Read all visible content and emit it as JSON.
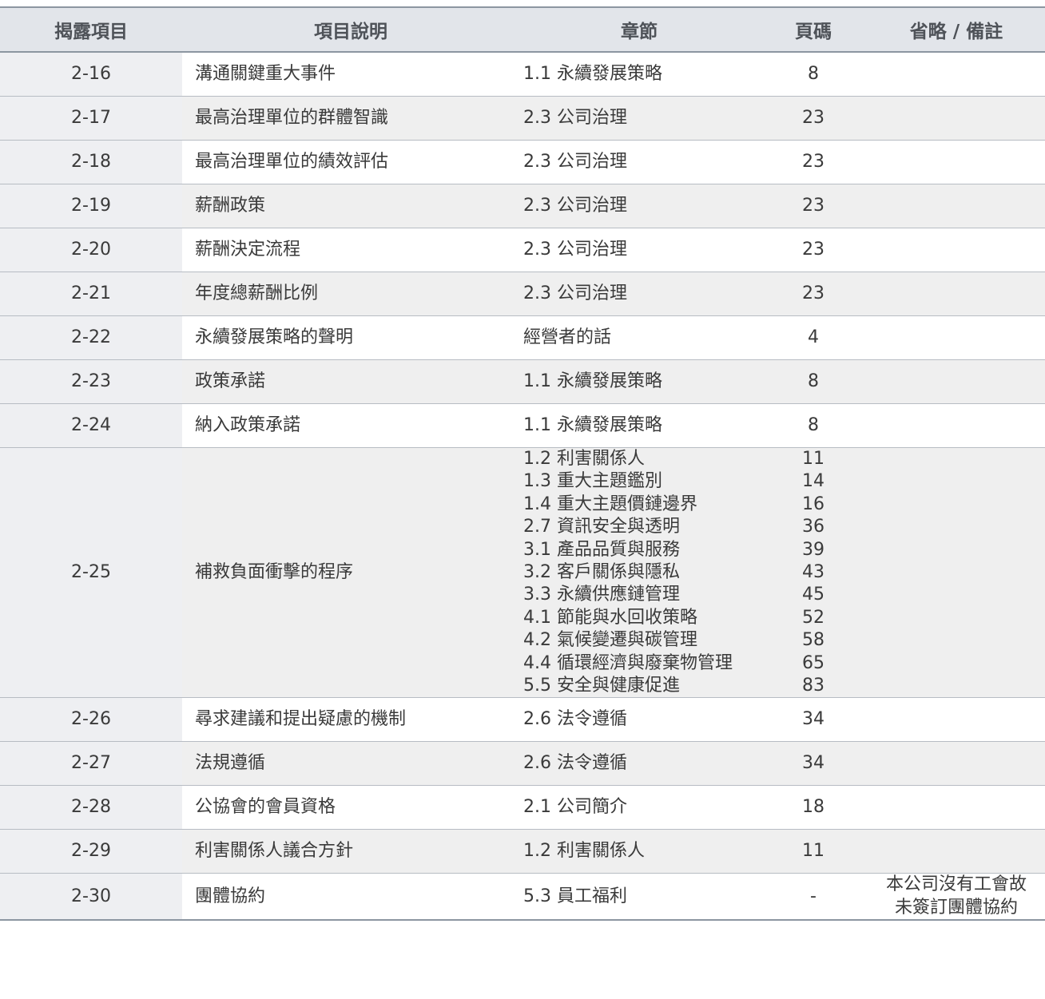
{
  "headers": {
    "code": "揭露項目",
    "desc": "項目說明",
    "chapter": "章節",
    "page": "頁碼",
    "note": "省略 / 備註"
  },
  "rows": [
    {
      "code": "2-16",
      "desc": "溝通關鍵重大事件",
      "chapter": "1.1 永續發展策略",
      "page": "8",
      "note": ""
    },
    {
      "code": "2-17",
      "desc": "最高治理單位的群體智識",
      "chapter": "2.3 公司治理",
      "page": "23",
      "note": ""
    },
    {
      "code": "2-18",
      "desc": "最高治理單位的績效評估",
      "chapter": "2.3 公司治理",
      "page": "23",
      "note": ""
    },
    {
      "code": "2-19",
      "desc": "薪酬政策",
      "chapter": "2.3 公司治理",
      "page": "23",
      "note": ""
    },
    {
      "code": "2-20",
      "desc": "薪酬決定流程",
      "chapter": "2.3 公司治理",
      "page": "23",
      "note": ""
    },
    {
      "code": "2-21",
      "desc": "年度總薪酬比例",
      "chapter": "2.3 公司治理",
      "page": "23",
      "note": ""
    },
    {
      "code": "2-22",
      "desc": "永續發展策略的聲明",
      "chapter": "經營者的話",
      "page": "4",
      "note": ""
    },
    {
      "code": "2-23",
      "desc": "政策承諾",
      "chapter": "1.1 永續發展策略",
      "page": "8",
      "note": ""
    },
    {
      "code": "2-24",
      "desc": "納入政策承諾",
      "chapter": "1.1 永續發展策略",
      "page": "8",
      "note": ""
    }
  ],
  "row_225": {
    "code": "2-25",
    "desc": "補救負面衝擊的程序",
    "chapters": [
      "1.2 利害關係人",
      "1.3 重大主題鑑別",
      "1.4 重大主題價鏈邊界",
      "2.7 資訊安全與透明",
      "3.1 產品品質與服務",
      "3.2 客戶關係與隱私",
      "3.3 永續供應鏈管理",
      "4.1 節能與水回收策略",
      "4.2 氣候變遷與碳管理",
      "4.4 循環經濟與廢棄物管理",
      "5.5 安全與健康促進"
    ],
    "pages": [
      "11",
      "14",
      "16",
      "36",
      "39",
      "43",
      "45",
      "52",
      "58",
      "65",
      "83"
    ]
  },
  "rows_after": [
    {
      "code": "2-26",
      "desc": "尋求建議和提出疑慮的機制",
      "chapter": "2.6 法令遵循",
      "page": "34",
      "note": ""
    },
    {
      "code": "2-27",
      "desc": "法規遵循",
      "chapter": "2.6 法令遵循",
      "page": "34",
      "note": ""
    },
    {
      "code": "2-28",
      "desc": "公協會的會員資格",
      "chapter": "2.1 公司簡介",
      "page": "18",
      "note": ""
    },
    {
      "code": "2-29",
      "desc": "利害關係人議合方針",
      "chapter": "1.2 利害關係人",
      "page": "11",
      "note": ""
    }
  ],
  "row_230": {
    "code": "2-30",
    "desc": "團體協約",
    "chapter": "5.3 員工福利",
    "page": "-",
    "note_lines": [
      "本公司沒有工會故",
      "未簽訂團體協約"
    ]
  }
}
